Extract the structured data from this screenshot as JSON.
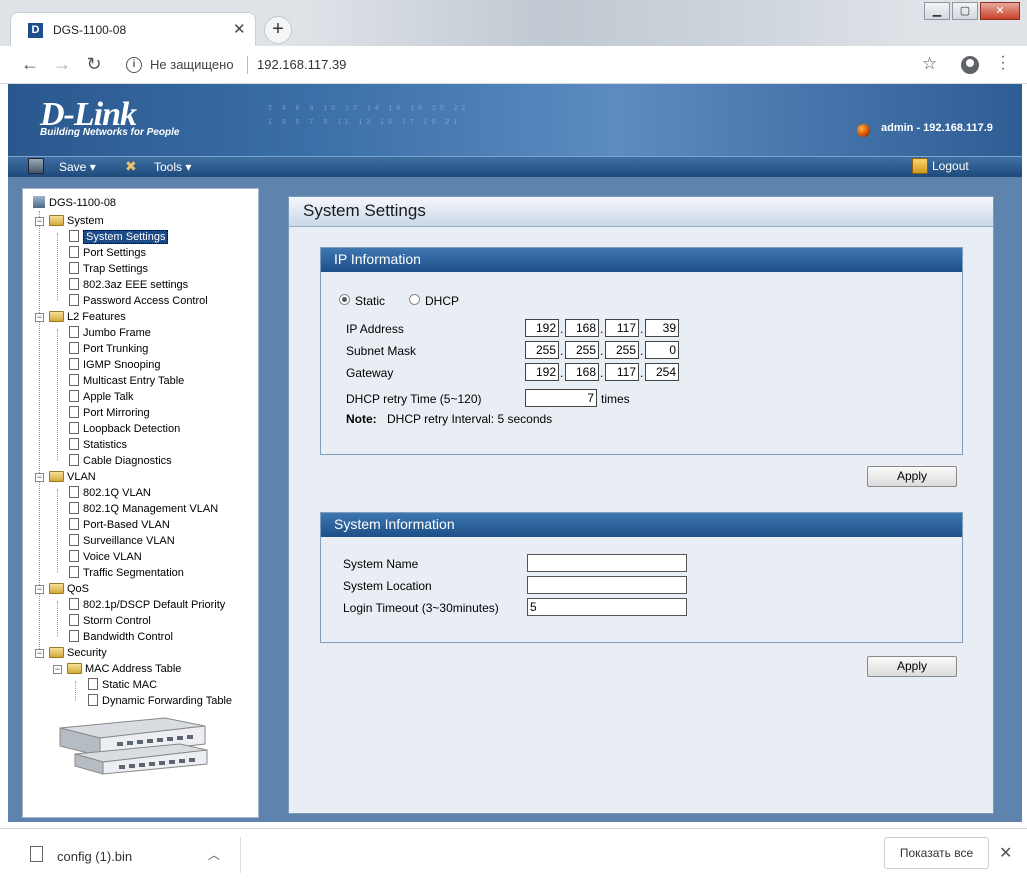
{
  "browser": {
    "tab_title": "DGS-1100-08",
    "favicon_letter": "D",
    "new_tab": "+",
    "security_text": "Не защищено",
    "url": "192.168.117.39"
  },
  "header": {
    "logo": "D-Link",
    "tagline": "Building Networks for People",
    "user": "admin - 192.168.117.9",
    "grid_numbers_1": "2 4 6 8 10 12 14 16 18 20 22",
    "grid_numbers_2": "1 3 5 7 9 11 13 15 17 19 21"
  },
  "menubar": {
    "save": "Save",
    "tools": "Tools",
    "logout": "Logout"
  },
  "tree": {
    "root": "DGS-1100-08",
    "system": "System",
    "system_items": [
      "System Settings",
      "Port Settings",
      "Trap Settings",
      "802.3az EEE settings",
      "Password Access Control"
    ],
    "l2": "L2 Features",
    "l2_items": [
      "Jumbo Frame",
      "Port Trunking",
      "IGMP Snooping",
      "Multicast Entry Table",
      "Apple Talk",
      "Port Mirroring",
      "Loopback Detection",
      "Statistics",
      "Cable Diagnostics"
    ],
    "vlan": "VLAN",
    "vlan_items": [
      "802.1Q VLAN",
      "802.1Q Management VLAN",
      "Port-Based VLAN",
      "Surveillance VLAN",
      "Voice VLAN",
      "Traffic Segmentation"
    ],
    "qos": "QoS",
    "qos_items": [
      "802.1p/DSCP Default Priority",
      "Storm Control",
      "Bandwidth Control"
    ],
    "security": "Security",
    "mac_table": "MAC Address Table",
    "mac_items": [
      "Static MAC",
      "Dynamic Forwarding Table"
    ]
  },
  "content": {
    "title": "System Settings",
    "ip_box": {
      "title": "IP Information",
      "static_label": "Static",
      "dhcp_label": "DHCP",
      "ip_label": "IP Address",
      "ip": [
        "192",
        "168",
        "117",
        "39"
      ],
      "mask_label": "Subnet Mask",
      "mask": [
        "255",
        "255",
        "255",
        "0"
      ],
      "gw_label": "Gateway",
      "gw": [
        "192",
        "168",
        "117",
        "254"
      ],
      "retry_label": "DHCP retry Time (5~120)",
      "retry_value": "7",
      "retry_unit": "times",
      "note_label": "Note:",
      "note_text": "DHCP retry Interval: 5 seconds",
      "apply": "Apply"
    },
    "sys_box": {
      "title": "System Information",
      "name_label": "System Name",
      "name_value": "",
      "location_label": "System Location",
      "location_value": "",
      "timeout_label": "Login Timeout (3~30minutes)",
      "timeout_value": "5",
      "apply": "Apply"
    }
  },
  "downloads": {
    "file": "config (1).bin",
    "show_all": "Показать все"
  }
}
